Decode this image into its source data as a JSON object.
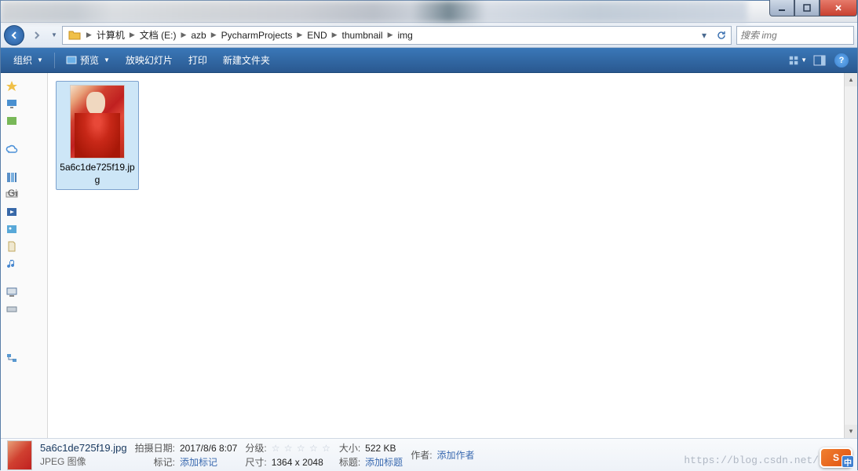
{
  "breadcrumbs": [
    "计算机",
    "文档 (E:)",
    "azb",
    "PycharmProjects",
    "END",
    "thumbnail",
    "img"
  ],
  "search": {
    "placeholder": "搜索 img"
  },
  "toolbar": {
    "organize": "组织",
    "preview": "预览",
    "slideshow": "放映幻灯片",
    "print": "打印",
    "newfolder": "新建文件夹"
  },
  "file": {
    "name": "5a6c1de725f19.jpg"
  },
  "details": {
    "filename": "5a6c1de725f19.jpg",
    "filetype": "JPEG 图像",
    "date_label": "拍摄日期:",
    "date_value": "2017/8/6 8:07",
    "tags_label": "标记:",
    "tags_value": "添加标记",
    "rating_label": "分级:",
    "dims_label": "尺寸:",
    "dims_value": "1364 x 2048",
    "size_label": "大小:",
    "size_value": "522 KB",
    "title_label": "标题:",
    "title_value": "添加标题",
    "author_label": "作者:",
    "author_value": "添加作者"
  },
  "watermark": "https://blog.csdn.net/qq_37",
  "ime": {
    "main": "S",
    "sub": "中"
  }
}
